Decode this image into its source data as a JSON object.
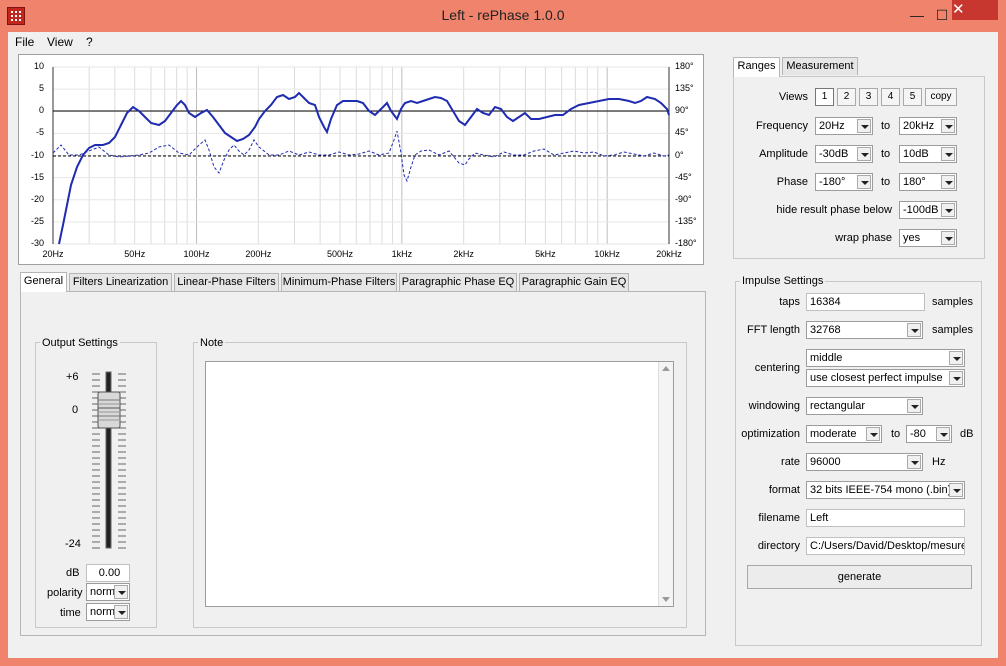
{
  "window": {
    "title": "Left  -  rePhase 1.0.0",
    "min": "—",
    "max": "☐",
    "close": "✕"
  },
  "menu": [
    "File",
    "View",
    "?"
  ],
  "graph": {
    "left_ticks": [
      "10",
      "5",
      "0",
      "-5",
      "-10",
      "-15",
      "-20",
      "-25",
      "-30"
    ],
    "right_ticks": [
      "180°",
      "135°",
      "90°",
      "45°",
      "0°",
      "-45°",
      "-90°",
      "-135°",
      "-180°"
    ],
    "x_ticks": [
      "20Hz",
      "50Hz",
      "100Hz",
      "200Hz",
      "500Hz",
      "1kHz",
      "2kHz",
      "5kHz",
      "10kHz",
      "20kHz"
    ]
  },
  "ranges": {
    "tabs": [
      "Ranges",
      "Measurement"
    ],
    "views_label": "Views",
    "views": [
      "1",
      "2",
      "3",
      "4",
      "5",
      "copy"
    ],
    "frequency_label": "Frequency",
    "freq_from": "20Hz",
    "freq_to": "20kHz",
    "amplitude_label": "Amplitude",
    "amp_from": "-30dB",
    "amp_to": "10dB",
    "phase_label": "Phase",
    "phase_from": "-180°",
    "phase_to": "180°",
    "hide_label": "hide result phase below",
    "hide_value": "-100dB",
    "wrap_label": "wrap phase",
    "wrap_value": "yes",
    "to": "to"
  },
  "tabs": [
    "General",
    "Filters Linearization",
    "Linear-Phase Filters",
    "Minimum-Phase Filters",
    "Paragraphic Phase EQ",
    "Paragraphic Gain EQ"
  ],
  "output": {
    "title": "Output Settings",
    "scale": [
      "+6",
      "0",
      "-24"
    ],
    "db_label": "dB",
    "db_value": "0.00",
    "polarity_label": "polarity",
    "polarity_value": "norm",
    "time_label": "time",
    "time_value": "norm"
  },
  "note": {
    "title": "Note"
  },
  "impulse": {
    "title": "Impulse Settings",
    "taps_label": "taps",
    "taps_value": "16384",
    "samples": "samples",
    "fft_label": "FFT length",
    "fft_value": "32768",
    "centering_label": "centering",
    "centering_value": "middle",
    "centering_mode": "use closest perfect impulse",
    "windowing_label": "windowing",
    "windowing_value": "rectangular",
    "optimization_label": "optimization",
    "optimization_value": "moderate",
    "opt_to": "to",
    "opt_db_value": "-80",
    "db": "dB",
    "rate_label": "rate",
    "rate_value": "96000",
    "hz": "Hz",
    "format_label": "format",
    "format_value": "32 bits IEEE-754 mono (.bin)",
    "filename_label": "filename",
    "filename_value": "Left",
    "directory_label": "directory",
    "directory_value": "C:/Users/David/Desktop/mesures",
    "generate": "generate"
  },
  "colors": {
    "titlebar": "#f0836c",
    "close": "#c7372f",
    "curve": "#1f2bb0"
  }
}
